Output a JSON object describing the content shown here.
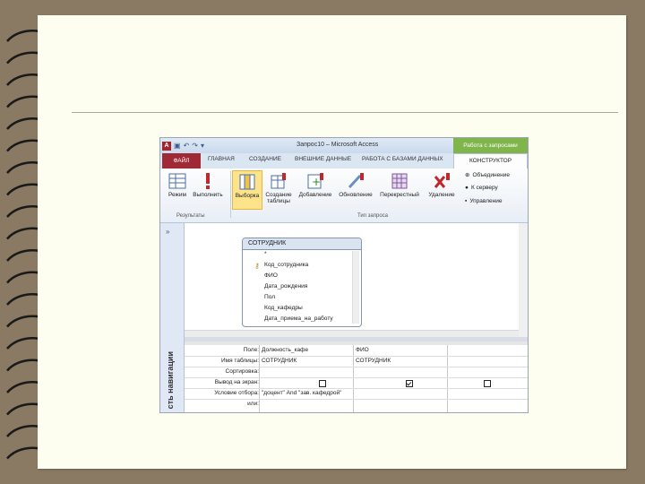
{
  "window": {
    "title": "Запрос10 – Microsoft Access",
    "context_tab": "Работа с запросами",
    "app_icon": "А"
  },
  "tabs": {
    "file": "ФАЙЛ",
    "home": "ГЛАВНАЯ",
    "create": "СОЗДАНИЕ",
    "external": "ВНЕШНИЕ ДАННЫЕ",
    "database": "РАБОТА С БАЗАМИ ДАННЫХ",
    "designer": "КОНСТРУКТОР"
  },
  "ribbon": {
    "view": "Режим",
    "run": "Выполнить",
    "select": "Выборка",
    "make_table_1": "Создание",
    "make_table_2": "таблицы",
    "append": "Добавление",
    "update": "Обновление",
    "crosstab": "Перекрестный",
    "delete": "Удаление",
    "union": "Объединение",
    "pass_through": "К серверу",
    "data_definition": "Управление",
    "group_results": "Результаты",
    "group_query_type": "Тип запроса"
  },
  "nav_pane": {
    "label": "сть навигации",
    "toggle": "»"
  },
  "table_box": {
    "title": "СОТРУДНИК",
    "fields": [
      "*",
      "Код_сотрудника",
      "ФИО",
      "Дата_рождения",
      "Пол",
      "Код_кафедры",
      "Дата_приема_на_работу"
    ]
  },
  "grid": {
    "row_labels": [
      "Поле:",
      "Имя таблицы:",
      "Сортировка:",
      "Вывод на экран:",
      "Условие отбора:",
      "или:"
    ],
    "col1": {
      "field": "Должность_кафе",
      "table": "СОТРУДНИК",
      "show": false,
      "criteria": "\"доцент\" And \"зав. кафедрой\""
    },
    "col2": {
      "field": "ФИО",
      "table": "СОТРУДНИК",
      "show": true
    },
    "col3": {
      "show": false
    }
  }
}
